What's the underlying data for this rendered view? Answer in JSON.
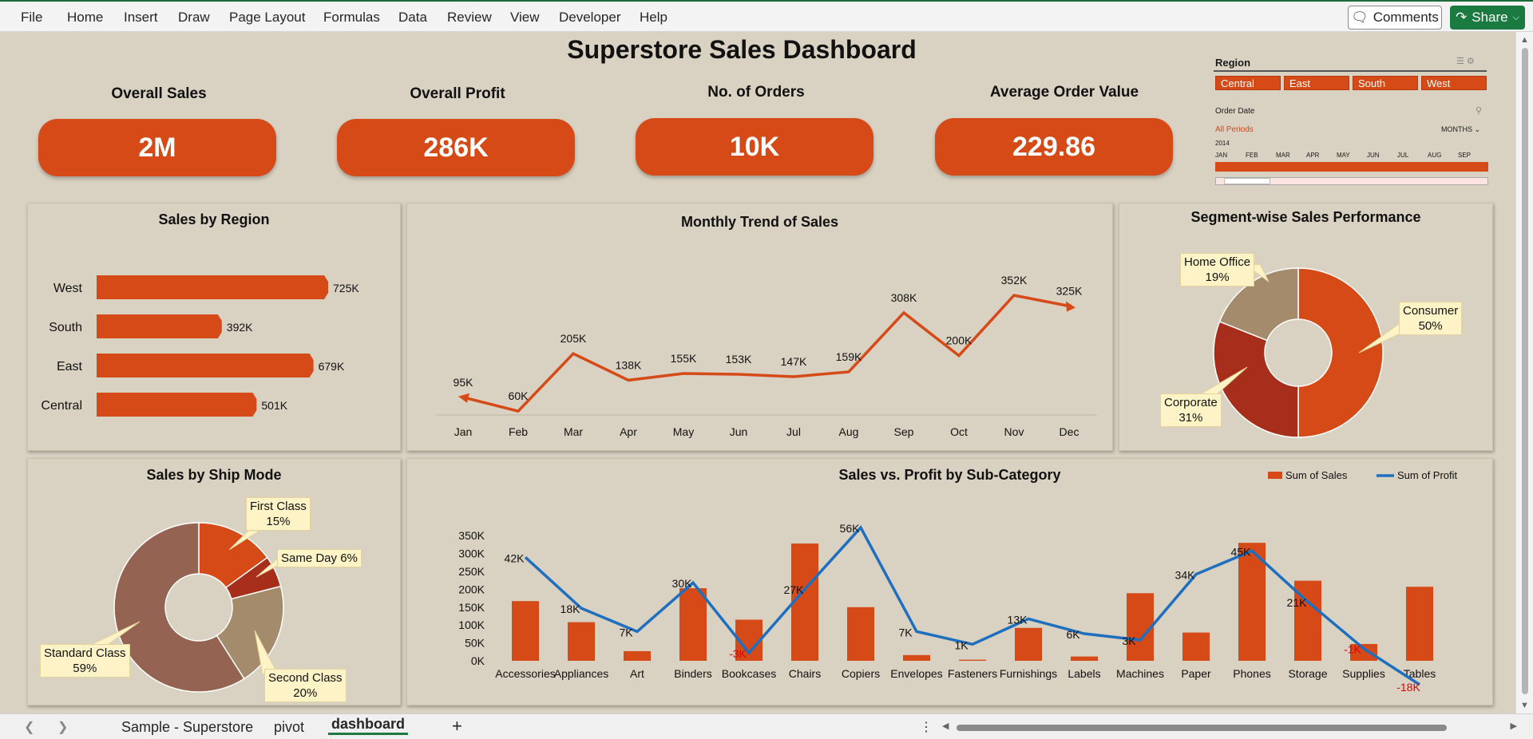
{
  "menu": {
    "items": [
      "File",
      "Home",
      "Insert",
      "Draw",
      "Page Layout",
      "Formulas",
      "Data",
      "Review",
      "View",
      "Developer",
      "Help"
    ],
    "comments_label": "Comments",
    "share_label": "Share"
  },
  "dashboard": {
    "title": "Superstore Sales Dashboard",
    "kpis": [
      {
        "label": "Overall Sales",
        "value": "2M"
      },
      {
        "label": "Overall Profit",
        "value": "286K"
      },
      {
        "label": "No. of Orders",
        "value": "10K"
      },
      {
        "label": "Average Order Value",
        "value": "229.86"
      }
    ]
  },
  "region_slicer": {
    "title": "Region",
    "options": [
      "Central",
      "East",
      "South",
      "West"
    ]
  },
  "timeline": {
    "title": "Order Date",
    "period": "All Periods",
    "unit": "MONTHS",
    "year": "2014",
    "months": [
      "JAN",
      "FEB",
      "MAR",
      "APR",
      "MAY",
      "JUN",
      "JUL",
      "AUG",
      "SEP"
    ]
  },
  "chart_data": [
    {
      "type": "bar",
      "title": "Sales by Region",
      "categories": [
        "West",
        "South",
        "East",
        "Central"
      ],
      "values": [
        725,
        392,
        679,
        501
      ],
      "labels": [
        "725K",
        "392K",
        "679K",
        "501K"
      ],
      "color": "#d64a18"
    },
    {
      "type": "line",
      "title": "Monthly Trend of Sales",
      "categories": [
        "Jan",
        "Feb",
        "Mar",
        "Apr",
        "May",
        "Jun",
        "Jul",
        "Aug",
        "Sep",
        "Oct",
        "Nov",
        "Dec"
      ],
      "values": [
        95,
        60,
        205,
        138,
        155,
        153,
        147,
        159,
        308,
        200,
        352,
        325
      ],
      "labels": [
        "95K",
        "60K",
        "205K",
        "138K",
        "155K",
        "153K",
        "147K",
        "159K",
        "308K",
        "200K",
        "352K",
        "325K"
      ],
      "color": "#d64a18"
    },
    {
      "type": "pie",
      "title": "Segment-wise Sales Performance",
      "slices": [
        {
          "name": "Consumer",
          "value": 50,
          "label": "50%",
          "color": "#d64a18"
        },
        {
          "name": "Corporate",
          "value": 31,
          "label": "31%",
          "color": "#a82e1c"
        },
        {
          "name": "Home Office",
          "value": 19,
          "label": "19%",
          "color": "#a38b6b"
        }
      ]
    },
    {
      "type": "pie",
      "title": "Sales by Ship Mode",
      "slices": [
        {
          "name": "First Class",
          "value": 15,
          "label": "15%",
          "color": "#d64a18"
        },
        {
          "name": "Same Day",
          "value": 6,
          "label": "6%",
          "color": "#a82e1c"
        },
        {
          "name": "Second Class",
          "value": 20,
          "label": "20%",
          "color": "#a38b6b"
        },
        {
          "name": "Standard Class",
          "value": 59,
          "label": "59%",
          "color": "#956352"
        }
      ]
    },
    {
      "type": "bar",
      "title": "Sales vs. Profit by Sub-Category",
      "categories": [
        "Accessories",
        "Appliances",
        "Art",
        "Binders",
        "Bookcases",
        "Chairs",
        "Copiers",
        "Envelopes",
        "Fasteners",
        "Furnishings",
        "Labels",
        "Machines",
        "Paper",
        "Phones",
        "Storage",
        "Supplies",
        "Tables"
      ],
      "series": [
        {
          "name": "Sum of Sales",
          "type": "bar",
          "color": "#d64a18",
          "values": [
            167,
            108,
            27,
            203,
            115,
            328,
            150,
            16,
            3,
            92,
            12,
            189,
            79,
            330,
            224,
            47,
            207
          ]
        },
        {
          "name": "Sum of Profit",
          "type": "line",
          "color": "#1f6fbf",
          "values": [
            42,
            18,
            7,
            30,
            -3,
            27,
            56,
            7,
            1,
            13,
            6,
            3,
            34,
            45,
            21,
            -1,
            -18
          ],
          "labels": [
            "42K",
            "18K",
            "7K",
            "30K",
            "-3K",
            "27K",
            "56K",
            "7K",
            "1K",
            "13K",
            "6K",
            "3K",
            "34K",
            "45K",
            "21K",
            "-1K",
            "-18K"
          ]
        }
      ],
      "ylim": [
        0,
        350
      ],
      "yticks": [
        "0K",
        "50K",
        "100K",
        "150K",
        "200K",
        "250K",
        "300K",
        "350K"
      ],
      "legend": "top-right"
    }
  ],
  "sheet_tabs": [
    "Sample - Superstore",
    "pivot",
    "dashboard"
  ],
  "active_tab": "dashboard"
}
